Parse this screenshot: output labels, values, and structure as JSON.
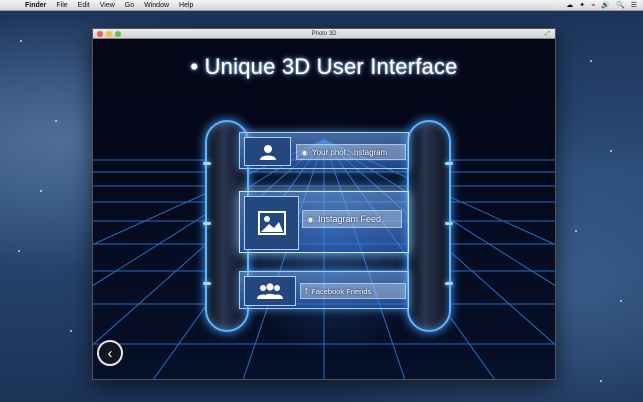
{
  "menubar": {
    "apple": "",
    "items": [
      "Finder",
      "File",
      "Edit",
      "View",
      "Go",
      "Window",
      "Help"
    ],
    "right": [
      "☁",
      "✦",
      "⌁",
      "🔊",
      "🔍",
      "☰"
    ]
  },
  "window": {
    "title": "Photo 3D",
    "headline": "• Unique 3D User Interface"
  },
  "panels": {
    "profile": {
      "label": "Your phot…nstagram"
    },
    "instagram": {
      "label": "Instagram Feed"
    },
    "facebook": {
      "label": "Facebook Friends",
      "badge": "f"
    }
  },
  "nav": {
    "back": "‹"
  },
  "colors": {
    "glow": "#5fb5ff",
    "grid": "#2b7fe0"
  }
}
